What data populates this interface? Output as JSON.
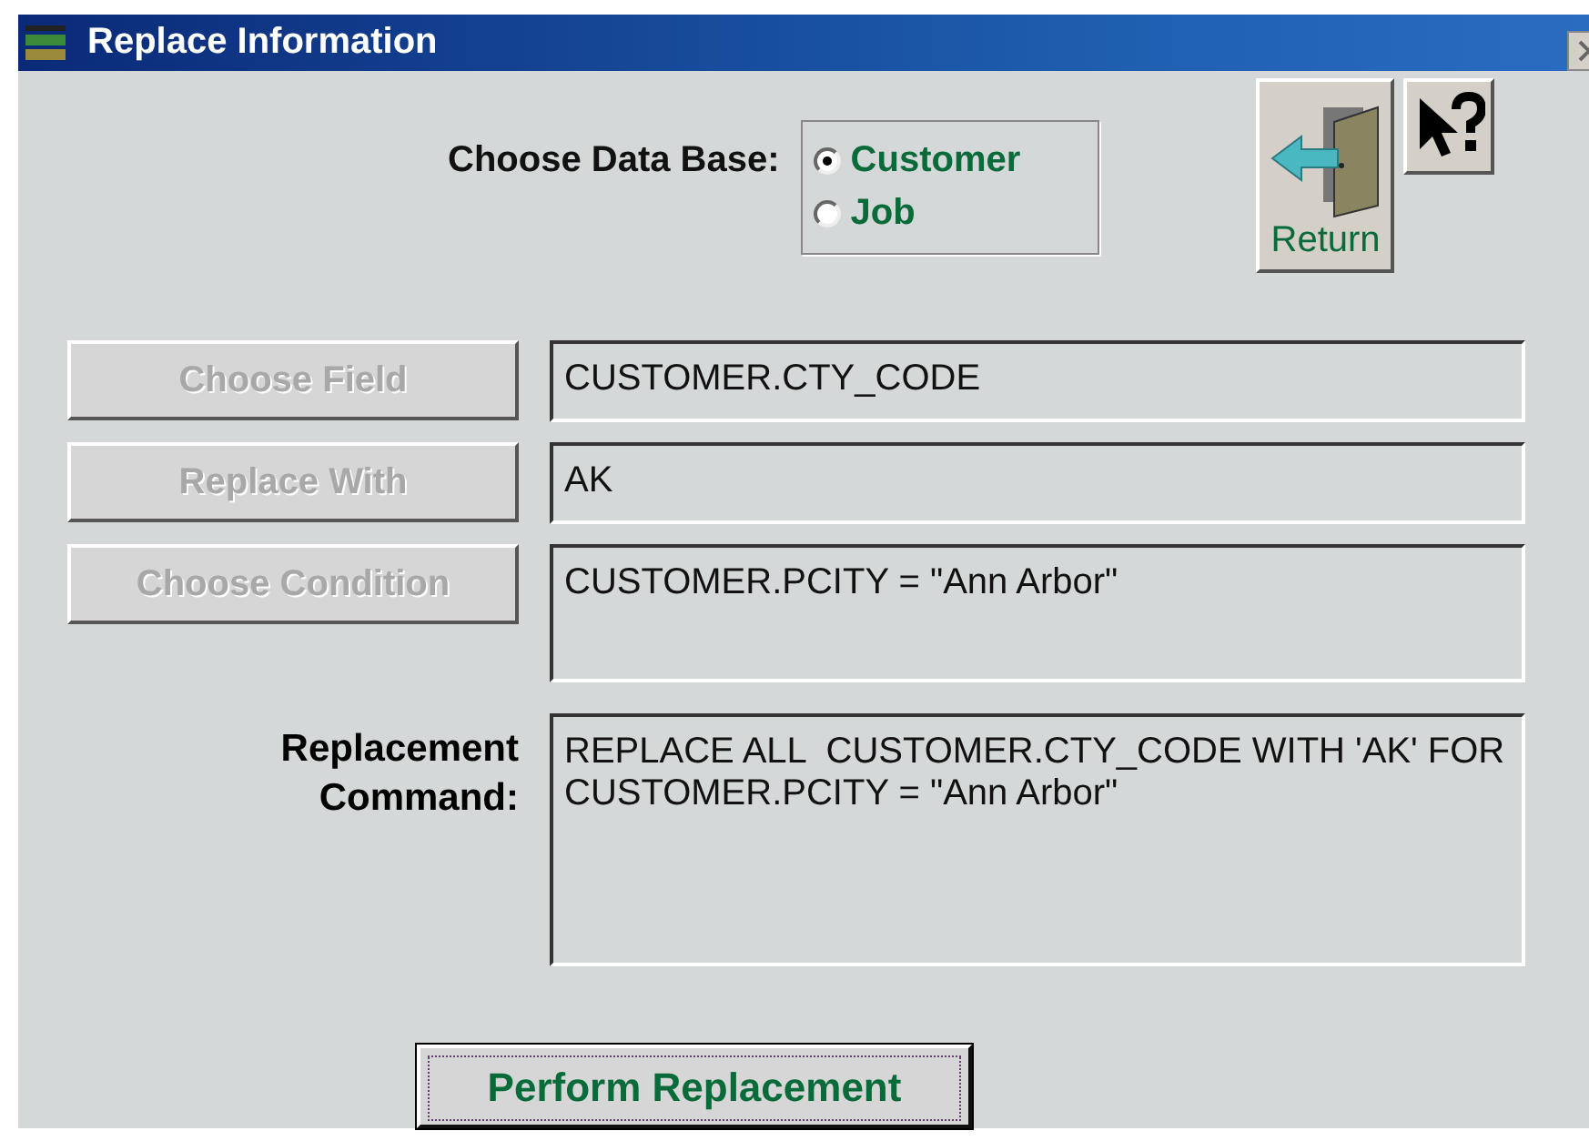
{
  "window": {
    "title": "Replace Information"
  },
  "database": {
    "label": "Choose Data Base:",
    "options": [
      {
        "label": "Customer",
        "selected": true
      },
      {
        "label": "Job",
        "selected": false
      }
    ]
  },
  "return_button": {
    "label": "Return"
  },
  "rows": [
    {
      "button": "Choose Field",
      "disabled": true,
      "value": "CUSTOMER.CTY_CODE",
      "kind": "single"
    },
    {
      "button": "Replace With",
      "disabled": true,
      "value": "AK",
      "kind": "single"
    },
    {
      "button": "Choose Condition",
      "disabled": true,
      "value": "CUSTOMER.PCITY = \"Ann Arbor\"",
      "kind": "multi"
    }
  ],
  "command": {
    "label": "Replacement Command:",
    "value": "REPLACE ALL  CUSTOMER.CTY_CODE WITH 'AK' FOR CUSTOMER.PCITY = \"Ann Arbor\""
  },
  "perform_button": {
    "label": "Perform Replacement"
  }
}
